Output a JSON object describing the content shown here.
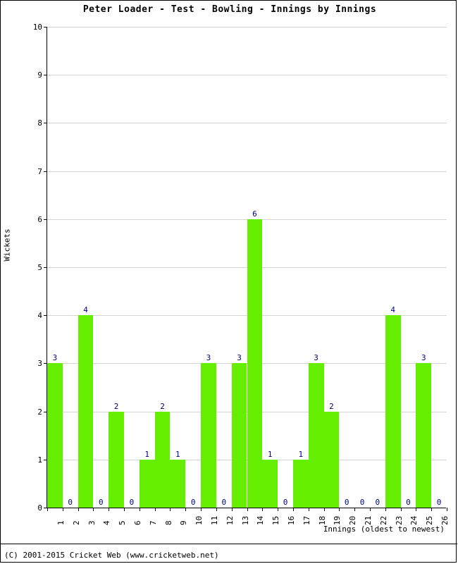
{
  "chart_data": {
    "type": "bar",
    "title": "Peter Loader - Test - Bowling - Innings by Innings",
    "xlabel": "Innings (oldest to newest)",
    "ylabel": "Wickets",
    "ylim": [
      0,
      10
    ],
    "ytick_labels": [
      "0",
      "1",
      "2",
      "3",
      "4",
      "5",
      "6",
      "7",
      "8",
      "9",
      "10"
    ],
    "grid": true,
    "legend": "none",
    "bar_color": "#66ee00",
    "label_color": "#000080",
    "categories": [
      "1",
      "2",
      "3",
      "4",
      "5",
      "6",
      "7",
      "8",
      "9",
      "10",
      "11",
      "12",
      "13",
      "14",
      "15",
      "16",
      "17",
      "18",
      "19",
      "20",
      "21",
      "22",
      "23",
      "24",
      "25",
      "26"
    ],
    "values": [
      3,
      0,
      4,
      0,
      2,
      0,
      1,
      2,
      1,
      0,
      3,
      0,
      3,
      6,
      1,
      0,
      1,
      3,
      2,
      0,
      0,
      0,
      4,
      0,
      3,
      0
    ],
    "data_labels": [
      "3",
      "0",
      "4",
      "0",
      "2",
      "0",
      "1",
      "2",
      "1",
      "0",
      "3",
      "0",
      "3",
      "6",
      "1",
      "0",
      "1",
      "3",
      "2",
      "0",
      "0",
      "0",
      "4",
      "0",
      "3",
      "0"
    ]
  },
  "footer": {
    "copyright": "(C) 2001-2015 Cricket Web (www.cricketweb.net)"
  }
}
